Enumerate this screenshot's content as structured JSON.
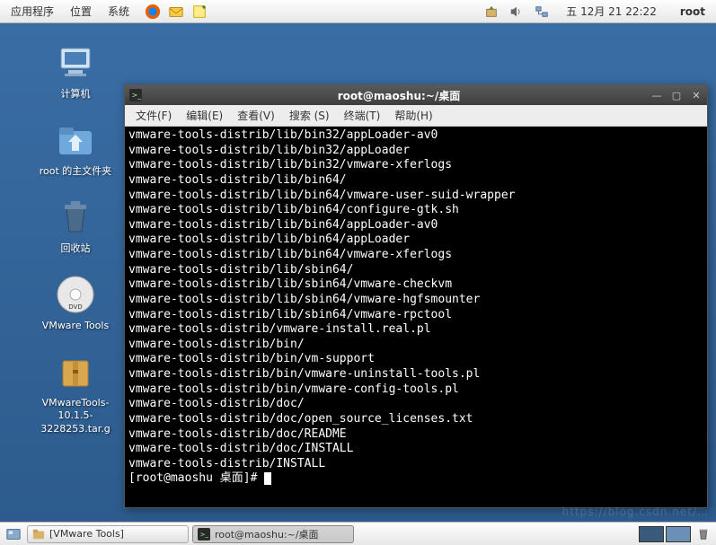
{
  "top_panel": {
    "menus": [
      "应用程序",
      "位置",
      "系统"
    ],
    "clock": "五 12月 21 22:22",
    "user": "root"
  },
  "desktop_icons": [
    {
      "label": "计算机",
      "name": "computer-icon"
    },
    {
      "label": "root 的主文件夹",
      "name": "home-folder-icon"
    },
    {
      "label": "回收站",
      "name": "trash-icon"
    },
    {
      "label": "VMware Tools",
      "name": "vmware-tools-dvd-icon"
    },
    {
      "label": "VMwareTools-10.1.5-3228253.tar.g",
      "name": "tarball-icon"
    }
  ],
  "terminal": {
    "title": "root@maoshu:~/桌面",
    "menus": [
      "文件(F)",
      "编辑(E)",
      "查看(V)",
      "搜索 (S)",
      "终端(T)",
      "帮助(H)"
    ],
    "lines": [
      "vmware-tools-distrib/lib/bin32/appLoader-av0",
      "vmware-tools-distrib/lib/bin32/appLoader",
      "vmware-tools-distrib/lib/bin32/vmware-xferlogs",
      "vmware-tools-distrib/lib/bin64/",
      "vmware-tools-distrib/lib/bin64/vmware-user-suid-wrapper",
      "vmware-tools-distrib/lib/bin64/configure-gtk.sh",
      "vmware-tools-distrib/lib/bin64/appLoader-av0",
      "vmware-tools-distrib/lib/bin64/appLoader",
      "vmware-tools-distrib/lib/bin64/vmware-xferlogs",
      "vmware-tools-distrib/lib/sbin64/",
      "vmware-tools-distrib/lib/sbin64/vmware-checkvm",
      "vmware-tools-distrib/lib/sbin64/vmware-hgfsmounter",
      "vmware-tools-distrib/lib/sbin64/vmware-rpctool",
      "vmware-tools-distrib/vmware-install.real.pl",
      "vmware-tools-distrib/bin/",
      "vmware-tools-distrib/bin/vm-support",
      "vmware-tools-distrib/bin/vmware-uninstall-tools.pl",
      "vmware-tools-distrib/bin/vmware-config-tools.pl",
      "vmware-tools-distrib/doc/",
      "vmware-tools-distrib/doc/open_source_licenses.txt",
      "vmware-tools-distrib/doc/README",
      "vmware-tools-distrib/doc/INSTALL",
      "vmware-tools-distrib/INSTALL"
    ],
    "prompt": "[root@maoshu 桌面]# "
  },
  "taskbar": {
    "items": [
      {
        "label": "[VMware Tools]",
        "name": "task-filemanager",
        "active": false,
        "icon": "folder"
      },
      {
        "label": "root@maoshu:~/桌面",
        "name": "task-terminal",
        "active": true,
        "icon": "terminal"
      }
    ]
  }
}
